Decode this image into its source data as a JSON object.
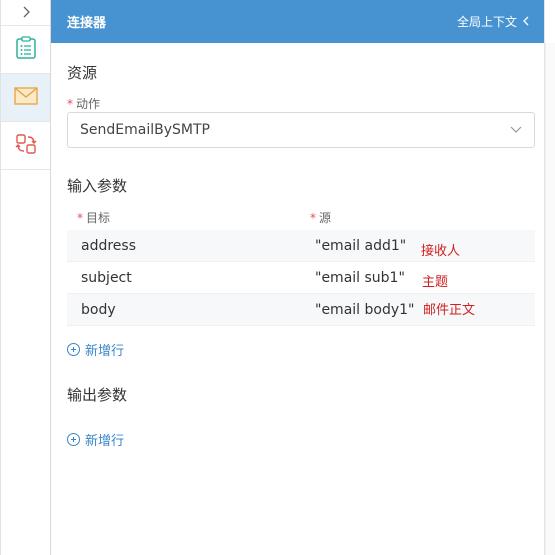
{
  "rail": {
    "toggle_icon": "chevron-right-icon",
    "items": [
      {
        "icon": "clipboard-list-icon",
        "color": "#2bb39b"
      },
      {
        "icon": "envelope-icon",
        "color": "#e6a23c"
      },
      {
        "icon": "convert-icon",
        "color": "#e05a4e"
      }
    ]
  },
  "header": {
    "title": "连接器",
    "context_label": "全局上下文",
    "context_icon": "chevron-left-icon",
    "bg_color": "#4793d1"
  },
  "resource": {
    "title": "资源",
    "action_label": "动作",
    "action_required": "*",
    "action_value": "SendEmailBySMTP"
  },
  "inputs": {
    "title": "输入参数",
    "col_target": "目标",
    "col_source": "源",
    "required_mark": "*",
    "rows": [
      {
        "target": "address",
        "source": "\"email add1\"",
        "note": "接收人"
      },
      {
        "target": "subject",
        "source": "\"email sub1\"",
        "note": "主题"
      },
      {
        "target": "body",
        "source": "\"email body1\"",
        "note": "邮件正文"
      }
    ],
    "add_label": "新增行"
  },
  "outputs": {
    "title": "输出参数",
    "add_label": "新增行"
  }
}
